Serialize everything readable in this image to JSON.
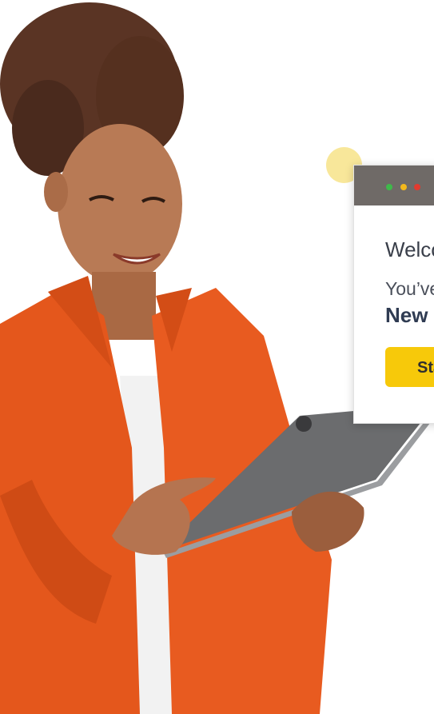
{
  "window": {
    "welcome_text": "Welco",
    "line1": "You’ve",
    "line2": "New",
    "button_label": "Sta"
  },
  "colors": {
    "titlebar": "#6f6a67",
    "traffic_green": "#3eb94a",
    "traffic_yellow": "#f2b81c",
    "traffic_red": "#e23a2f",
    "button": "#f7c90a",
    "accent_dot": "#f8e79a",
    "shirt": "#e4571c"
  }
}
